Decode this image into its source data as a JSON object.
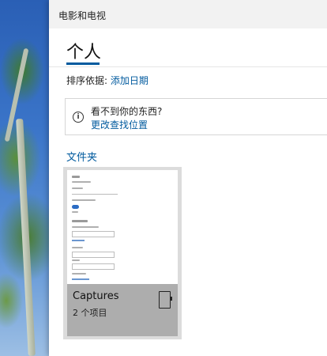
{
  "window": {
    "title": "电影和电视"
  },
  "page": {
    "title": "个人"
  },
  "sort": {
    "label": "排序依据: ",
    "value": "添加日期"
  },
  "info": {
    "icon": "info-circle-icon",
    "heading": "看不到你的东西?",
    "link": "更改查找位置"
  },
  "folders": {
    "header": "文件夹",
    "items": [
      {
        "name": "Captures",
        "count": "2 个项目",
        "icon": "tablet-device-icon"
      }
    ]
  },
  "colors": {
    "accent": "#005a9e",
    "tile_footer": "#adadad"
  }
}
